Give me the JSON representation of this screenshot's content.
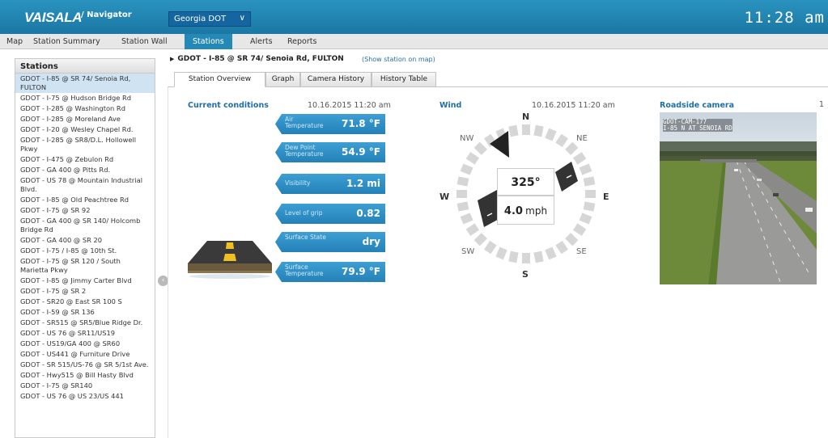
{
  "header": {
    "logo": "VAISALA",
    "app_name": "/ Navigator",
    "org_selected": "Georgia DOT",
    "clock": "11:28 am",
    "brand_color": "#1f86b3"
  },
  "tabs": [
    "Map",
    "Station Summary",
    "Station Wall",
    "Stations",
    "Alerts",
    "Reports"
  ],
  "active_tab": "Stations",
  "sidebar": {
    "title": "Stations",
    "items": [
      "GDOT - I-85 @ SR 74/ Senoia Rd, FULTON",
      "GDOT - I-75 @ Hudson Bridge Rd",
      "GDOT - I-285 @ Washington Rd",
      "GDOT - I-285 @ Moreland Ave",
      "GDOT - I-20 @ Wesley Chapel Rd.",
      "GDOT - I-285 @ SR8/D.L. Hollowell Pkwy",
      "GDOT - I-475 @ Zebulon Rd",
      "GDOT - GA 400 @ Pitts Rd.",
      "GDOT - US 78 @ Mountain Industrial Blvd.",
      "GDOT - I-85 @ Old Peachtree Rd",
      "GDOT - I-75 @ SR 92",
      "GDOT - GA 400 @ SR 140/ Holcomb Bridge Rd",
      "GDOT - GA 400 @ SR 20",
      "GDOT - I-75 / I-85 @ 10th St.",
      "GDOT - I-75 @ SR 120 / South Marietta Pkwy",
      "GDOT - I-85 @ Jimmy Carter Blvd",
      "GDOT - I-75 @ SR 2",
      "GDOT - SR20 @ East SR 100 S",
      "GDOT - I-59 @ SR 136",
      "GDOT - SR515 @ SR5/Blue Ridge Dr.",
      "GDOT - US 76 @ SR11/US19",
      "GDOT - US19/GA 400 @ SR60",
      "GDOT - US441 @ Furniture Drive",
      "GDOT - SR 515/US-76 @ SR 5/1st Ave.",
      "GDOT - Hwy515 @ Bill Hasty Blvd",
      "GDOT - I-75 @ SR140",
      "GDOT - US 76 @ US 23/US 441"
    ]
  },
  "station": {
    "name": "GDOT - I-85 @ SR 74/ Senoia Rd, FULTON",
    "show_on_map": "(Show station on map)"
  },
  "subtabs": [
    "Station Overview",
    "Graph",
    "Camera History",
    "History Table"
  ],
  "active_subtab": "Station Overview",
  "conditions": {
    "title": "Current conditions",
    "time": "10.16.2015 11:20 am",
    "items": [
      {
        "label": "Air Temperature",
        "value": "71.8 °F"
      },
      {
        "label": "Dew Point Temperature",
        "value": "54.9 °F"
      },
      {
        "label": "Visibility",
        "value": "1.2 mi"
      },
      {
        "label": "Level of grip",
        "value": "0.82"
      },
      {
        "label": "Surface State",
        "value": "dry"
      },
      {
        "label": "Surface Temperature",
        "value": "79.9 °F"
      }
    ]
  },
  "wind": {
    "title": "Wind",
    "time": "10.16.2015 11:20 am",
    "direction": "325°",
    "direction_degrees": 325,
    "speed": "4.0",
    "speed_unit": "mph",
    "compass": [
      "N",
      "NE",
      "E",
      "SE",
      "S",
      "SW",
      "W",
      "NW"
    ]
  },
  "camera": {
    "title": "Roadside camera",
    "overlay_line1": "GDOT-CAM-177",
    "overlay_line2": "I-85 N AT SENOIA RD",
    "partial_next": "1"
  }
}
